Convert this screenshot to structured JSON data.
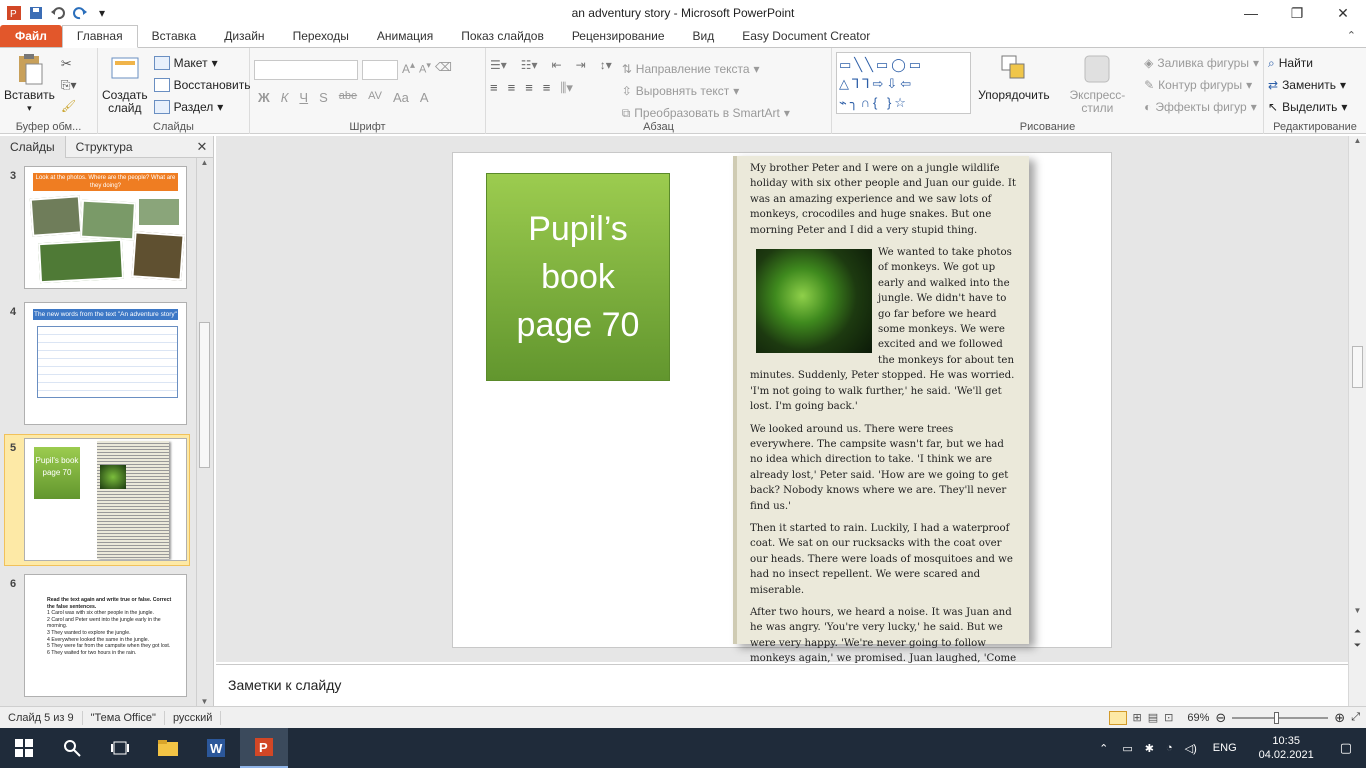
{
  "window": {
    "title": "an adventury story  -  Microsoft PowerPoint"
  },
  "tabs": [
    "Файл",
    "Главная",
    "Вставка",
    "Дизайн",
    "Переходы",
    "Анимация",
    "Показ слайдов",
    "Рецензирование",
    "Вид",
    "Easy Document Creator"
  ],
  "ribbon": {
    "clipboard": {
      "paste": "Вставить",
      "label": "Буфер обм..."
    },
    "slides": {
      "new_slide": "Создать слайд",
      "layout": "Макет",
      "reset": "Восстановить",
      "section": "Раздел",
      "label": "Слайды"
    },
    "font": {
      "label": "Шрифт",
      "bold": "Ж",
      "italic": "К",
      "underline": "Ч",
      "shadow": "S",
      "strike": "abe",
      "spacing": "AV",
      "case": "Aa",
      "color": "A"
    },
    "paragraph": {
      "label": "Абзац",
      "text_dir": "Направление текста",
      "align_text": "Выровнять текст",
      "smartart": "Преобразовать в SmartArt"
    },
    "drawing": {
      "label": "Рисование",
      "arrange": "Упорядочить",
      "quick_styles": "Экспресс-стили",
      "fill": "Заливка фигуры",
      "outline": "Контур фигуры",
      "effects": "Эффекты фигур"
    },
    "editing": {
      "label": "Редактирование",
      "find": "Найти",
      "replace": "Заменить",
      "select": "Выделить"
    }
  },
  "slides_pane": {
    "tab_slides": "Слайды",
    "tab_outline": "Структура",
    "thumbs": [
      {
        "num": "3",
        "title": "Look at the photos. Where are the people? What are they doing?"
      },
      {
        "num": "4",
        "title": "The new words from the text \"An adventure story\""
      },
      {
        "num": "5",
        "title": "Pupil's book page 70"
      },
      {
        "num": "6",
        "title": "Read the text again and write true or false. Correct the false sentences.",
        "items": [
          "1  Carol was with six other people in the jungle.",
          "2  Carol and Peter went into the jungle early in the morning.",
          "3  They wanted to explore the jungle.",
          "4  Everywhere looked the same in the jungle.",
          "5  They were far from the campsite when they got lost.",
          "6  They waited for two hours in the rain."
        ]
      }
    ]
  },
  "slide": {
    "box_text": "Pupil’s book page 70",
    "paragraphs": [
      "My brother Peter and I were on a jungle wildlife holiday with six other people and Juan our guide. It was an amazing experience and we saw lots of monkeys, crocodiles and huge snakes. But one morning Peter and I did a very stupid thing.",
      "We wanted to take photos of monkeys. We got up early and walked into the jungle. We didn't have to go far before we heard some monkeys. We were excited and we followed the monkeys for about ten minutes. Suddenly, Peter stopped. He was worried. 'I'm not going to walk further,' he said. 'We'll get lost. I'm going back.'",
      "We looked around us. There were trees everywhere. The campsite wasn't far, but we had no idea which direction to take. 'I think we are already lost,' Peter said. 'How are we going to get back? Nobody knows where we are. They'll never find us.'",
      "Then it started to rain. Luckily, I had a waterproof coat. We sat on our rucksacks with the coat over our heads. There were loads of mosquitoes and we had no insect repellent. We were scared and miserable.",
      "After two hours, we heard a noise. It was Juan and he was angry. 'You're very lucky,' he said. But we were very happy. 'We're never going to follow monkeys again,' we promised. Juan laughed, 'Come on. Let's go back to camp.'"
    ]
  },
  "notes": {
    "placeholder": "Заметки к слайду"
  },
  "status": {
    "slide": "Слайд 5 из 9",
    "theme": "\"Тема Office\"",
    "lang": "русский",
    "zoom": "69%"
  },
  "taskbar": {
    "lang": "ENG",
    "time": "10:35",
    "date": "04.02.2021"
  }
}
